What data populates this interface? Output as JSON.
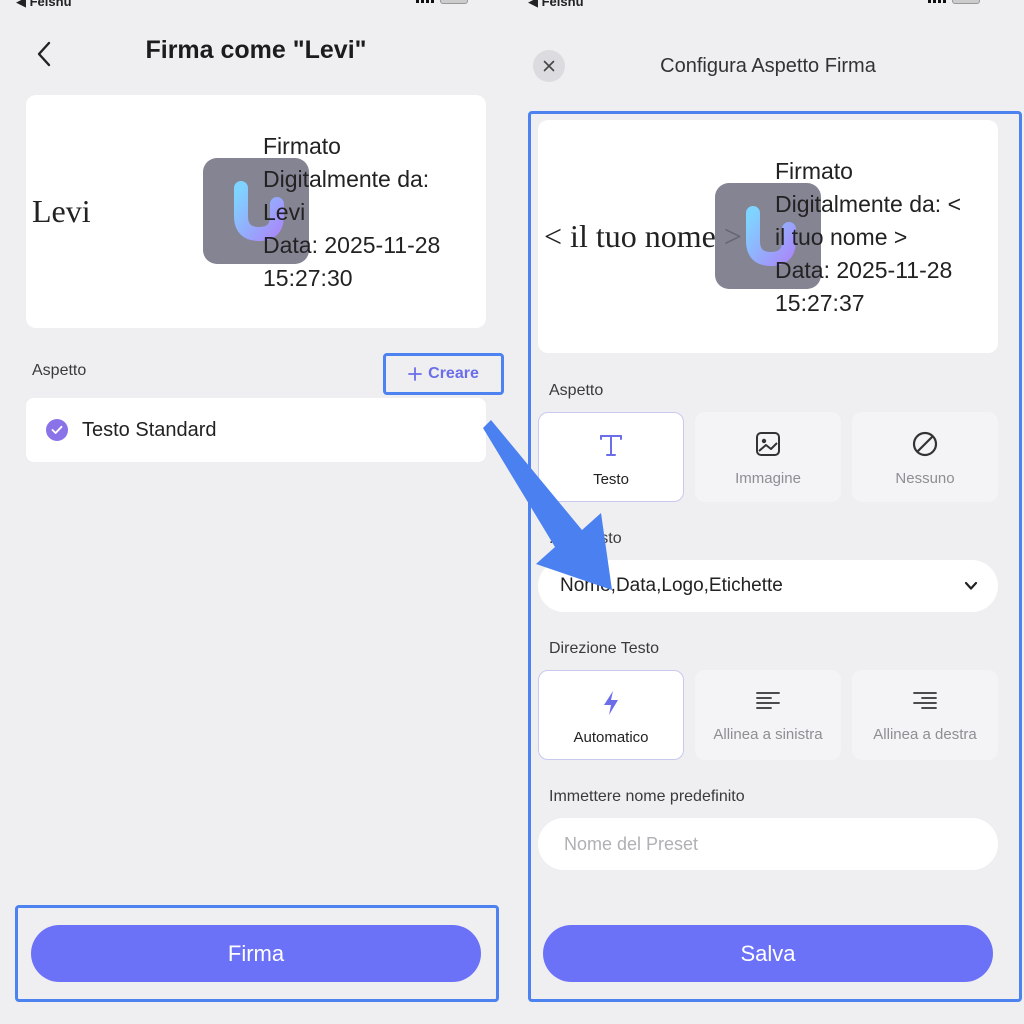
{
  "status": {
    "carrier": "◀ Feishu"
  },
  "left": {
    "title": "Firma come \"Levi\"",
    "preview": {
      "name": "Levi",
      "lines": [
        "Firmato",
        "Digitalmente da:",
        "Levi",
        "Data: 2025-11-28",
        "15:27:30"
      ]
    },
    "appearance_label": "Aspetto",
    "create_label": "Creare",
    "standard_option": "Testo Standard",
    "sign_button": "Firma"
  },
  "right": {
    "title": "Configura Aspetto Firma",
    "preview": {
      "name": "< il tuo nome >",
      "lines": [
        "Firmato",
        "Digitalmente da: <",
        "il tuo nome >",
        "Data: 2025-11-28",
        "15:27:37"
      ]
    },
    "appearance_label": "Aspetto",
    "appearance_options": [
      {
        "label": "Testo",
        "icon": "text-t-icon"
      },
      {
        "label": "Immagine",
        "icon": "image-icon"
      },
      {
        "label": "Nessuno",
        "icon": "none-circle-icon"
      }
    ],
    "text_fields_label": "... di Testo",
    "text_fields_value": "Nome,Data,Logo,Etichette",
    "direction_label": "Direzione Testo",
    "direction_options": [
      {
        "label": "Automatico",
        "icon": "lightning-icon"
      },
      {
        "label": "Allinea a sinistra",
        "icon": "align-left-icon"
      },
      {
        "label": "Allinea a destra",
        "icon": "align-right-icon"
      }
    ],
    "preset_label": "Immettere nome predefinito",
    "preset_placeholder": "Nome del Preset",
    "save_button": "Salva"
  },
  "colors": {
    "accent": "#6c72f7",
    "highlight": "#4c83f0",
    "check": "#8a72e8"
  }
}
